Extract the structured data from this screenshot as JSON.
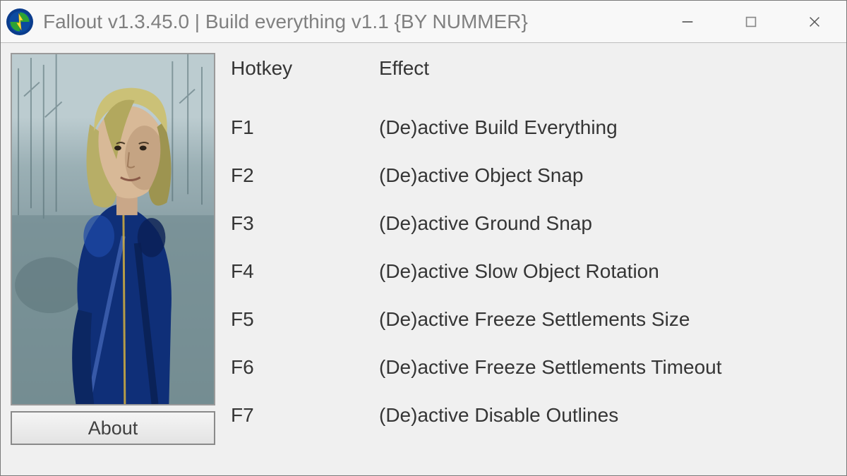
{
  "window": {
    "title": "Fallout v1.3.45.0 | Build everything v1.1 {BY NUMMER}"
  },
  "about": {
    "label": "About"
  },
  "table": {
    "headers": {
      "hotkey": "Hotkey",
      "effect": "Effect"
    },
    "rows": [
      {
        "hotkey": "F1",
        "effect": "(De)active Build Everything"
      },
      {
        "hotkey": "F2",
        "effect": "(De)active Object Snap"
      },
      {
        "hotkey": "F3",
        "effect": "(De)active Ground Snap"
      },
      {
        "hotkey": "F4",
        "effect": "(De)active Slow Object Rotation"
      },
      {
        "hotkey": "F5",
        "effect": "(De)active Freeze Settlements Size"
      },
      {
        "hotkey": "F6",
        "effect": "(De)active Freeze Settlements Timeout"
      },
      {
        "hotkey": "F7",
        "effect": "(De)active Disable Outlines"
      }
    ]
  }
}
